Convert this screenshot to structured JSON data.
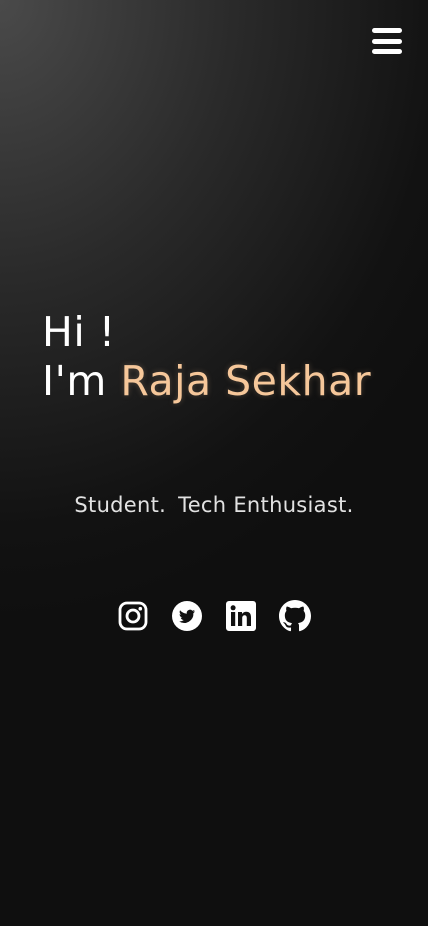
{
  "header": {
    "menu_icon": "hamburger-menu-icon"
  },
  "hero": {
    "greeting": "Hi !",
    "intro": "I'm",
    "name": "Raja Sekhar",
    "name_color": "#f6c79a"
  },
  "tagline": {
    "items": [
      "Student.",
      "Tech Enthusiast."
    ]
  },
  "socials": [
    {
      "icon": "instagram-icon"
    },
    {
      "icon": "twitter-icon"
    },
    {
      "icon": "linkedin-icon"
    },
    {
      "icon": "github-icon"
    }
  ],
  "colors": {
    "background_dark": "#101010",
    "background_light": "#4a4a4a",
    "text": "#ffffff",
    "accent": "#f6c79a"
  }
}
